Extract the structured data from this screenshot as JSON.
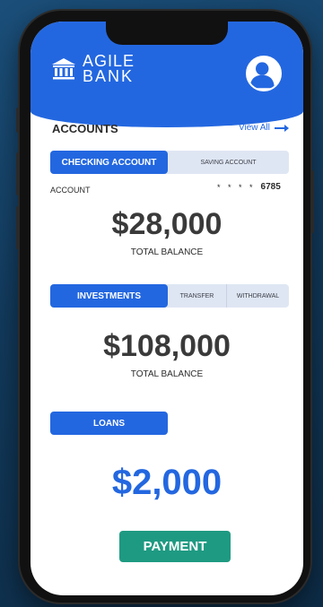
{
  "brand": {
    "line1": "AGILE",
    "line2": "BANK"
  },
  "accounts": {
    "title": "ACCOUNTS",
    "view_all": "View All",
    "tabs": [
      {
        "label": "CHECKING ACCOUNT",
        "active": true
      },
      {
        "label": "SAVING ACCOUNT",
        "active": false
      }
    ],
    "account_label": "ACCOUNT",
    "account_mask": "* * * *",
    "account_last4": "6785",
    "balance": "$28,000",
    "balance_label": "TOTAL BALANCE"
  },
  "investments": {
    "tabs": [
      {
        "label": "INVESTMENTS",
        "active": true
      },
      {
        "label": "TRANSFER",
        "active": false
      },
      {
        "label": "WITHDRAWAL",
        "active": false
      }
    ],
    "balance": "$108,000",
    "balance_label": "TOTAL BALANCE"
  },
  "loans": {
    "label": "LOANS",
    "amount": "$2,000",
    "payment_label": "PAYMENT"
  },
  "colors": {
    "primary": "#2367e0",
    "payment": "#1f9a82",
    "tab_inactive": "#dfe6f3"
  },
  "icons": [
    "bank-icon",
    "user-avatar-icon",
    "arrow-right-icon"
  ]
}
